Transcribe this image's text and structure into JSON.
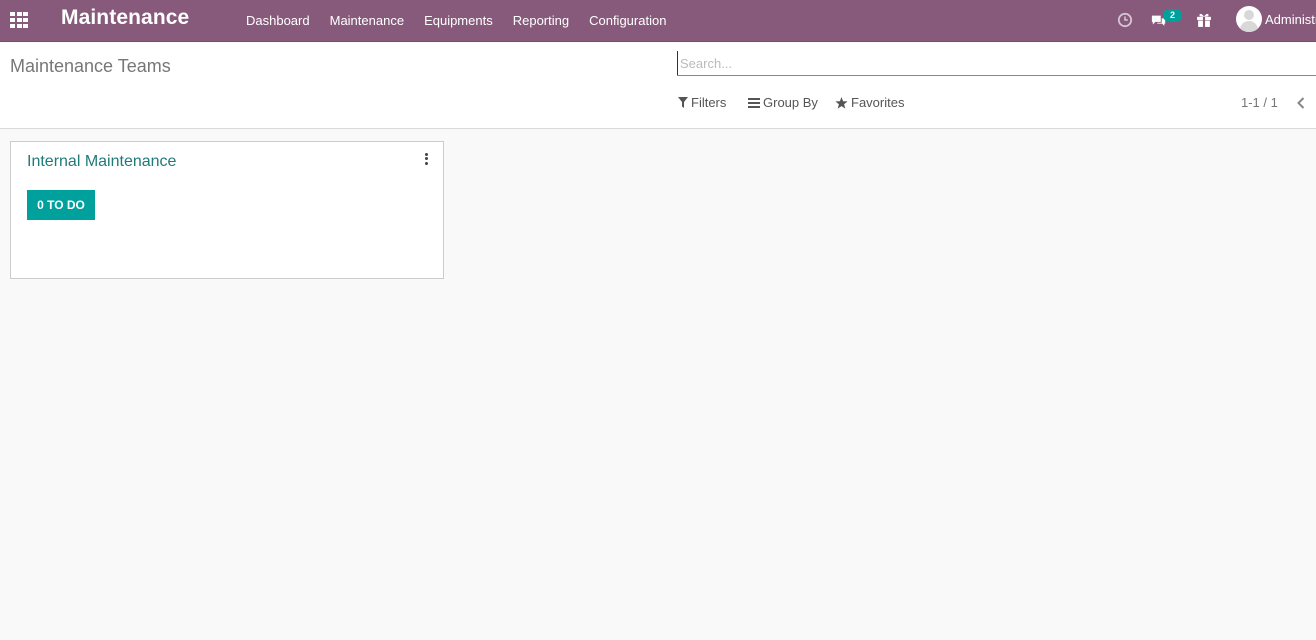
{
  "navbar": {
    "app_title": "Maintenance",
    "menu": [
      "Dashboard",
      "Maintenance",
      "Equipments",
      "Reporting",
      "Configuration"
    ],
    "messages_count": "2",
    "user_name": "Administrator",
    "bg_color": "#875a7b"
  },
  "control_panel": {
    "breadcrumb": "Maintenance Teams",
    "search_placeholder": "Search...",
    "filters_label": "Filters",
    "group_by_label": "Group By",
    "favorites_label": "Favorites",
    "pager": "1-1 / 1"
  },
  "kanban": {
    "cards": [
      {
        "title": "Internal Maintenance",
        "todo_label": "0 TO DO"
      }
    ]
  },
  "accent_color": "#00a09d"
}
